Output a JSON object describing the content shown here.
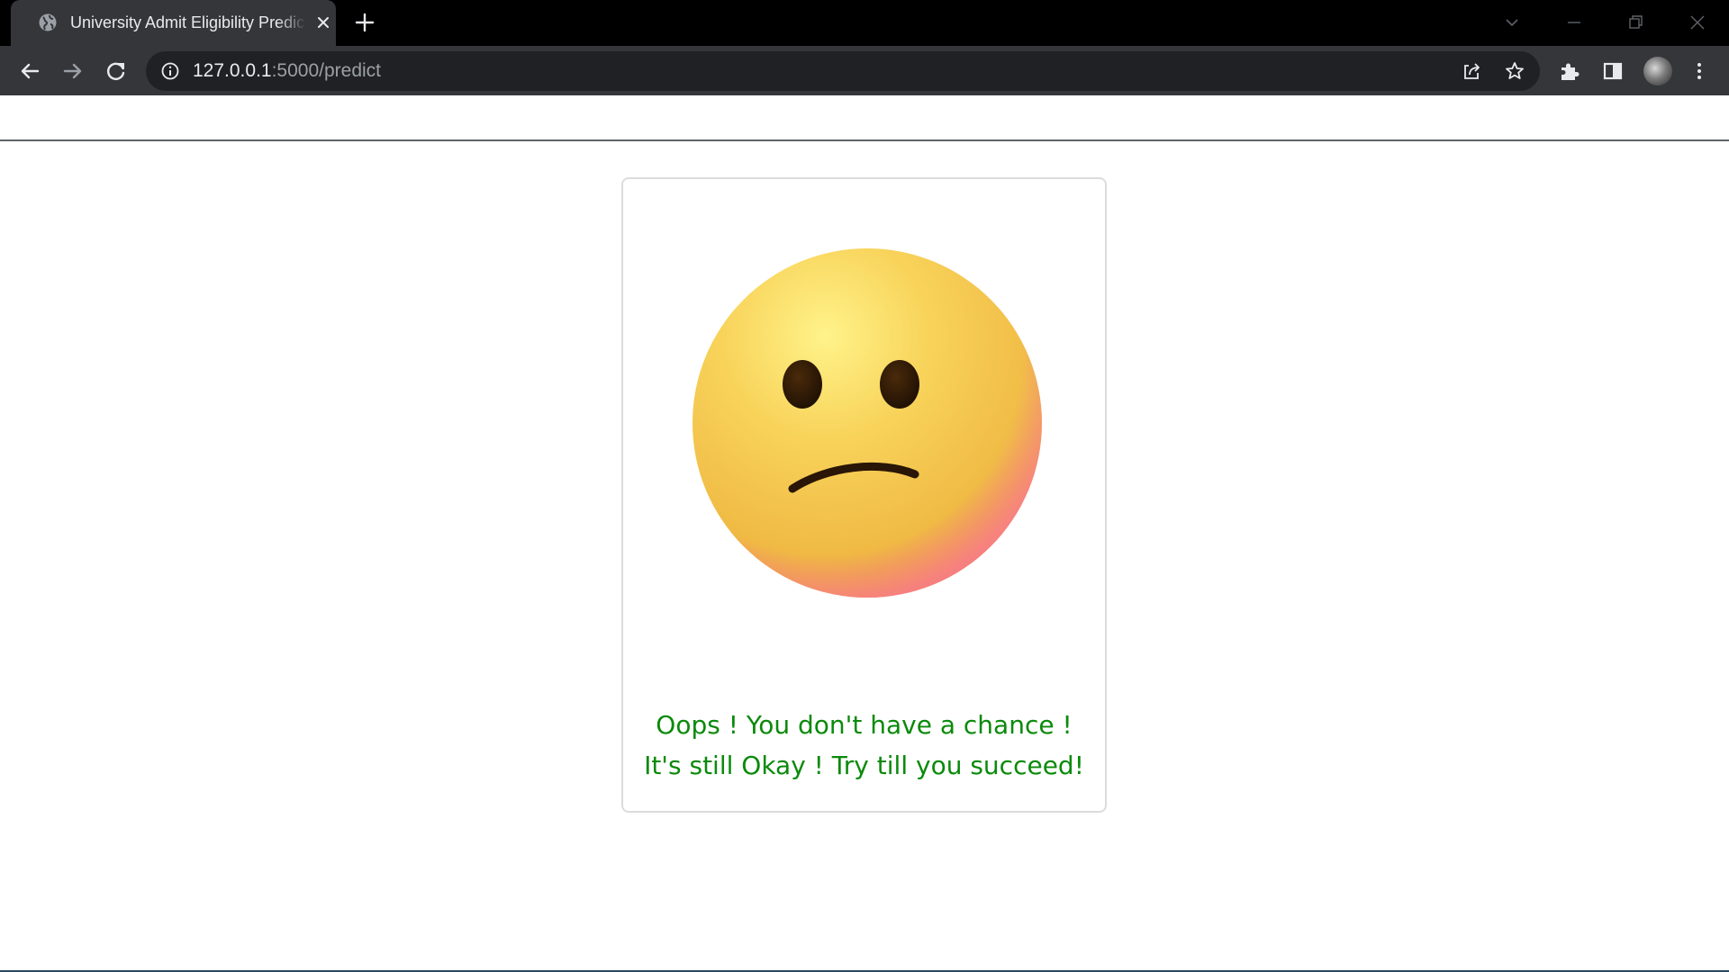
{
  "browser": {
    "tab": {
      "title": "University Admit Eligibility Predictor"
    },
    "address_bar": {
      "host": "127.0.0.1",
      "path": ":5000/predict"
    }
  },
  "page": {
    "image": {
      "icon": "confused-face-emoji"
    },
    "message": {
      "line1": "Oops ! You don't have a chance !",
      "line2": "It's still Okay ! Try till you succeed!",
      "color": "#0b8a0b"
    }
  }
}
